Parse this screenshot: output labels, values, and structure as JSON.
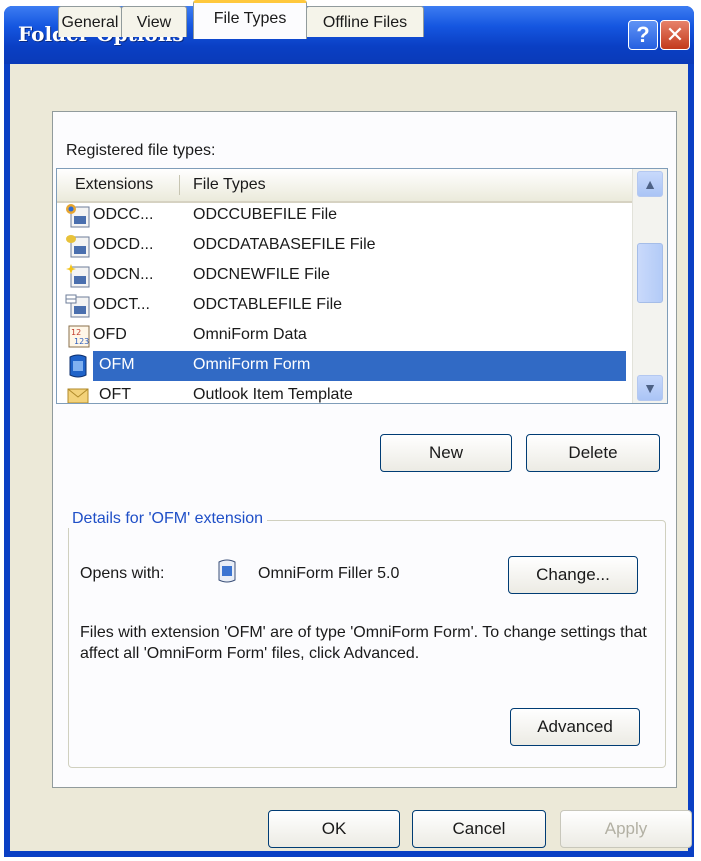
{
  "window": {
    "title": "Folder Options"
  },
  "tabs": [
    {
      "label": "General"
    },
    {
      "label": "View"
    },
    {
      "label": "File Types"
    },
    {
      "label": "Offline Files"
    }
  ],
  "registered_label": "Registered file types:",
  "list": {
    "columns": [
      "Extensions",
      "File Types"
    ],
    "rows": [
      {
        "ext": "ODCC...",
        "type": "ODCCUBEFILE File",
        "icon": "odc-cube-file-icon"
      },
      {
        "ext": "ODCD...",
        "type": "ODCDATABASEFILE File",
        "icon": "odc-database-file-icon"
      },
      {
        "ext": "ODCN...",
        "type": "ODCNEWFILE File",
        "icon": "odc-new-file-icon"
      },
      {
        "ext": "ODCT...",
        "type": "ODCTABLEFILE File",
        "icon": "odc-table-file-icon"
      },
      {
        "ext": "OFD",
        "type": "OmniForm Data",
        "icon": "omniform-data-icon"
      },
      {
        "ext": "OFM",
        "type": "OmniForm Form",
        "icon": "omniform-form-icon",
        "selected": true
      },
      {
        "ext": "OFT",
        "type": "Outlook Item Template",
        "icon": "outlook-template-icon"
      }
    ]
  },
  "buttons": {
    "new": "New",
    "delete": "Delete",
    "change": "Change...",
    "advanced": "Advanced",
    "ok": "OK",
    "cancel": "Cancel",
    "apply": "Apply"
  },
  "details": {
    "title": "Details for 'OFM' extension",
    "opens_with_label": "Opens with:",
    "opens_with_app": "OmniForm Filler 5.0",
    "description": "Files with extension 'OFM' are of type 'OmniForm Form'.  To change settings that affect all 'OmniForm Form' files, click Advanced."
  },
  "colors": {
    "title_bar": "#0a3fc4",
    "selection": "#316ac5",
    "dialog_bg": "#ece9d8",
    "active_tab_accent": "#ffc83c"
  }
}
